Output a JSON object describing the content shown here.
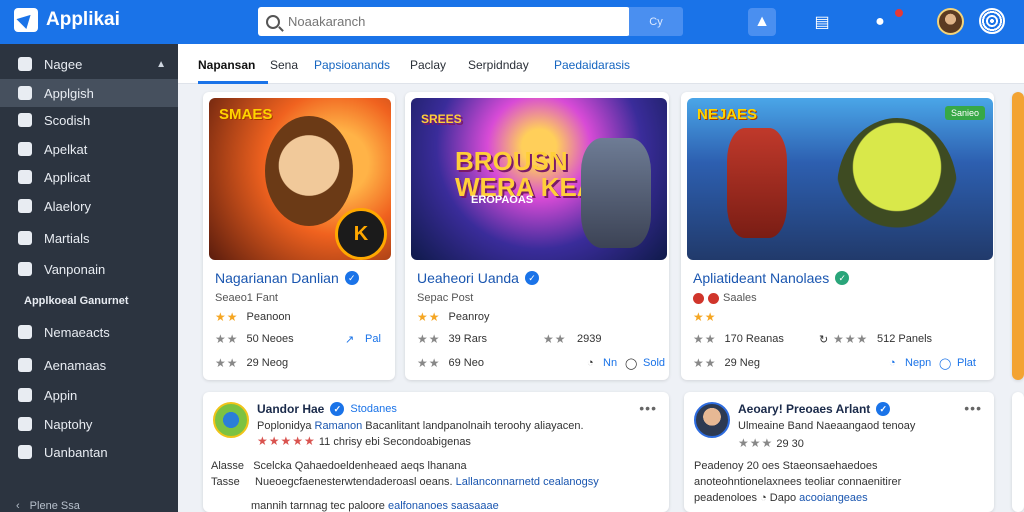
{
  "app": {
    "title": "Applikai"
  },
  "search": {
    "placeholder": "Noaakaranch",
    "button_label": "Cy"
  },
  "topbar": {
    "upload_icon": "upload-icon",
    "cart_icon": "cart-icon",
    "user_icon": "user-icon",
    "avatar": "avatar",
    "globe_icon": "globe-icon"
  },
  "sidebar": {
    "items": [
      {
        "label": "Nagee",
        "icon": "home-icon"
      },
      {
        "label": "Applgish",
        "icon": "apps-icon"
      },
      {
        "label": "Scodish",
        "icon": "square-icon"
      },
      {
        "label": "Apelkat",
        "icon": "search-icon"
      },
      {
        "label": "Applicat",
        "icon": "grid-icon"
      },
      {
        "label": "Alaelory",
        "icon": "bookmark-icon"
      },
      {
        "label": "Martials",
        "icon": "chat-icon"
      },
      {
        "label": "Vanponain",
        "icon": "video-icon"
      },
      {
        "label": "Nemaeacts",
        "icon": "settings-icon"
      },
      {
        "label": "Aenamaas",
        "icon": "rocket-icon"
      },
      {
        "label": "Appin",
        "icon": "pin-icon"
      },
      {
        "label": "Naptohy",
        "icon": "list-icon"
      },
      {
        "label": "Uanbantan",
        "icon": "puzzle-icon"
      }
    ],
    "section_label": "Applkoeal Ganurnet",
    "footer_label": "Plene Ssa"
  },
  "tabs": [
    "Napansan",
    "Sena",
    "Papsioanands",
    "Paclay",
    "Serpidnday",
    "Paedaidarasis"
  ],
  "cards": [
    {
      "thumb_title": "SMAES",
      "badge_text": "K",
      "title": "Nagarianan Danlian",
      "subtitle": "Seaeo1 Fant",
      "line1_stars": "★★",
      "line1_text": "Peanoon",
      "line2_stars": "★★",
      "line2_text": "50 Neoes",
      "line2_action": "Pal",
      "line3_stars": "★★",
      "line3_text": "29 Neog"
    },
    {
      "thumb_title": "BROUSN WERA KEAK",
      "thumb_sub": "EROPAOAS",
      "small_title": "SREES",
      "title": "Ueaheori Uanda",
      "subtitle": "Sepac Post",
      "line1_stars": "★★",
      "line1_text": "Peanroy",
      "line2_stars": "★★",
      "line2_text": "39 Rars",
      "line2_rating_stars": "★★",
      "line2_rating_text": "2939",
      "line3_stars": "★★",
      "line3_text": "69 Neo",
      "line3_action1": "Nn",
      "line3_action2": "Sold"
    },
    {
      "thumb_title": "NEJAES",
      "thumb_tag": "Sanieo",
      "title": "Apliatideant Nanolaes",
      "subtitle": "Saales",
      "line1_stars": "★★",
      "line2_stars": "★★",
      "line2_text": "170 Reanas",
      "line2_rating_stars": "★★★",
      "line2_rating_text": "512 Panels",
      "line3_stars": "★★",
      "line3_text": "29 Neg",
      "line3_action1": "Nepn",
      "line3_action2": "Plat"
    }
  ],
  "posts": [
    {
      "author": "Uandor Hae",
      "author_sub": "Stodanes",
      "line1_prefix": "Poplonidya",
      "line1_blue": "Ramanon",
      "line1_rest": "Bacanlitant landpanolnaih teroohy aliayacen.",
      "line2_stars": "★★★★★",
      "line2_text": "11 chrisy ebi",
      "line2_rest": "Secondoabigenas",
      "line3_label": "Alasse",
      "line3_text": "Scelcka Qahaedoeldenheaed aeqs lhanana",
      "line4_label": "Tasse",
      "line4_text": "Nueoegcfaenesterwtendaderoasl oeans.",
      "line4_blue": "Lallanconnarnetd cealanogsy",
      "line5_text": "mannih tarnnag tec paloore",
      "line5_blue": "ealfonanoes saasaaae"
    },
    {
      "author": "Aeoary! Preoaes Arlant",
      "line1_text": "Ulmeaine Band Naeaangaod tenoay",
      "line2_stars": "★★★",
      "line2_text": "29 30",
      "line3_text": "Peadenoy 20 oes Staeonsaehaedoes",
      "line4_text": "anoteohntionelaxnees teoliar connaenitirer",
      "line5_text": "peadenoloes",
      "line5_rest": "Dapo",
      "line5_blue": "acooiangeaes"
    }
  ],
  "colors": {
    "brand": "#1a73e8",
    "sidebar": "#2c3440",
    "star": "#f5a623"
  }
}
